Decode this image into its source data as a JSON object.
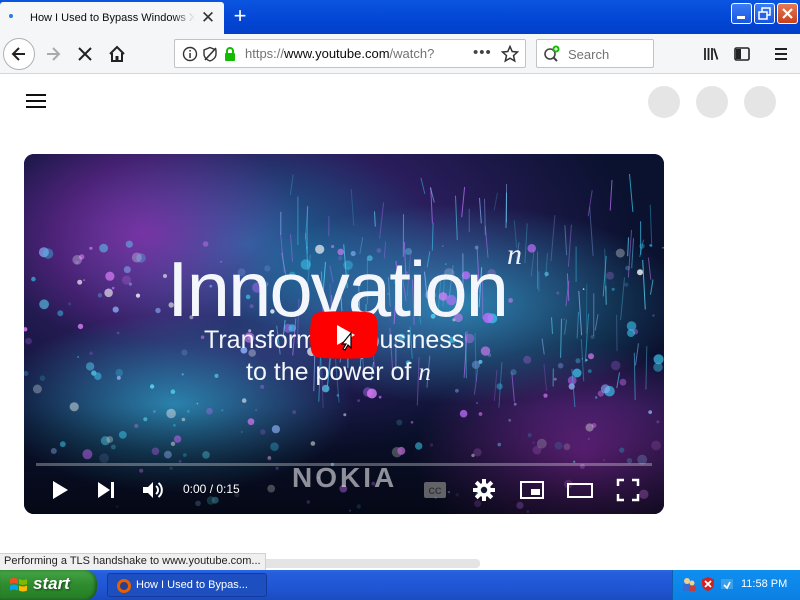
{
  "browser": {
    "tab_title": "How I Used to Bypass Windows XP",
    "tab_close_glyph": "✕",
    "new_tab_glyph": "+",
    "url_prefix": "https://",
    "url_host": "www.youtube.com",
    "url_path": "/watch?",
    "page_actions_glyph": "•••",
    "search_placeholder": "Search"
  },
  "video": {
    "headline": "Innovation",
    "headline_superscript": "n",
    "line1": "Transform       business",
    "line2_text": "to the power of ",
    "line2_italic": "n",
    "brand_logo": "NOKIA",
    "time": "0:00 / 0:15",
    "progress_fraction": 0.0
  },
  "status_text": "Performing a TLS handshake to www.youtube.com...",
  "taskbar": {
    "start_label": "start",
    "task_label": "How I Used to Bypas...",
    "clock": "11:58 PM"
  },
  "colors": {
    "titlebar_blue": "#0345d4",
    "youtube_red": "#ff0000",
    "start_green": "#2e8b2e",
    "taskbar_blue": "#2055d4"
  }
}
